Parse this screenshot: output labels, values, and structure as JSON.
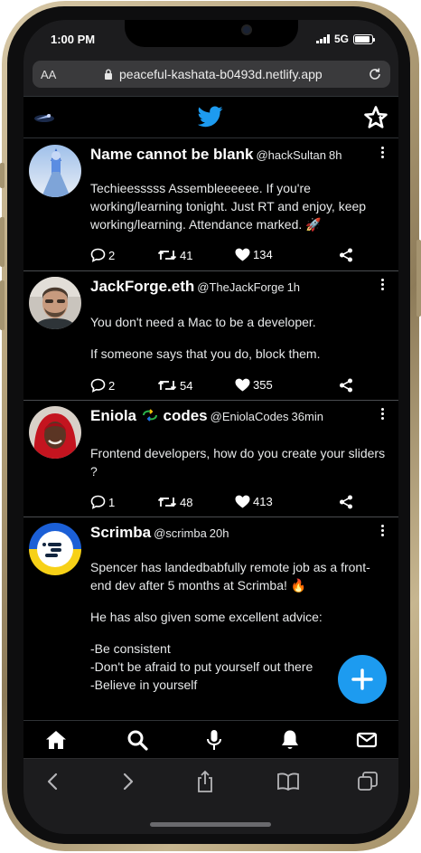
{
  "status_bar": {
    "time": "1:00 PM",
    "network": "5G",
    "battery_level": 0.9
  },
  "browser": {
    "text_size_label": "AA",
    "url": "peaceful-kashata-b0493d.netlify.app"
  },
  "app": {
    "logo_icon": "twitter-bird-icon",
    "header_action_icon": "sparkle-star-icon",
    "accent_color": "#1d9bf0",
    "background_color": "#000000"
  },
  "tweets": [
    {
      "name": "Name cannot be blank",
      "handle": "@hackSultan",
      "time": "8h",
      "paragraphs": [
        "Techieesssss Assembleeeeee. If you're working/learning tonight. Just RT and enjoy, keep working/learning. Attendance marked. 🚀"
      ],
      "replies": "2",
      "retweets": "41",
      "likes": "134"
    },
    {
      "name": "JackForge.eth",
      "handle": "@TheJackForge",
      "time": "1h",
      "paragraphs": [
        "You don't need a Mac to be a developer.",
        "If someone says that you do, block them."
      ],
      "replies": "2",
      "retweets": "54",
      "likes": "355"
    },
    {
      "name_prefix": "Eniola",
      "name_suffix": "codes",
      "handle": "@EniolaCodes",
      "time": "36min",
      "paragraphs": [
        "Frontend developers, how do you create your sliders ?"
      ],
      "replies": "1",
      "retweets": "48",
      "likes": "413"
    },
    {
      "name": "Scrimba",
      "handle": "@scrimba",
      "time": "20h",
      "paragraphs": [
        "Spencer has landedbabfully remote job as a front-end dev after 5 months at Scrimba! 🔥",
        "He has also given some excellent advice:",
        "-Be consistent\n-Don't be afraid to put yourself out there\n-Believe in yourself"
      ]
    }
  ],
  "bottom_nav": [
    "home-icon",
    "search-icon",
    "microphone-icon",
    "bell-icon",
    "mail-icon"
  ],
  "safari_toolbar": [
    "back-icon",
    "forward-icon",
    "share-icon",
    "bookmarks-icon",
    "tabs-icon"
  ]
}
